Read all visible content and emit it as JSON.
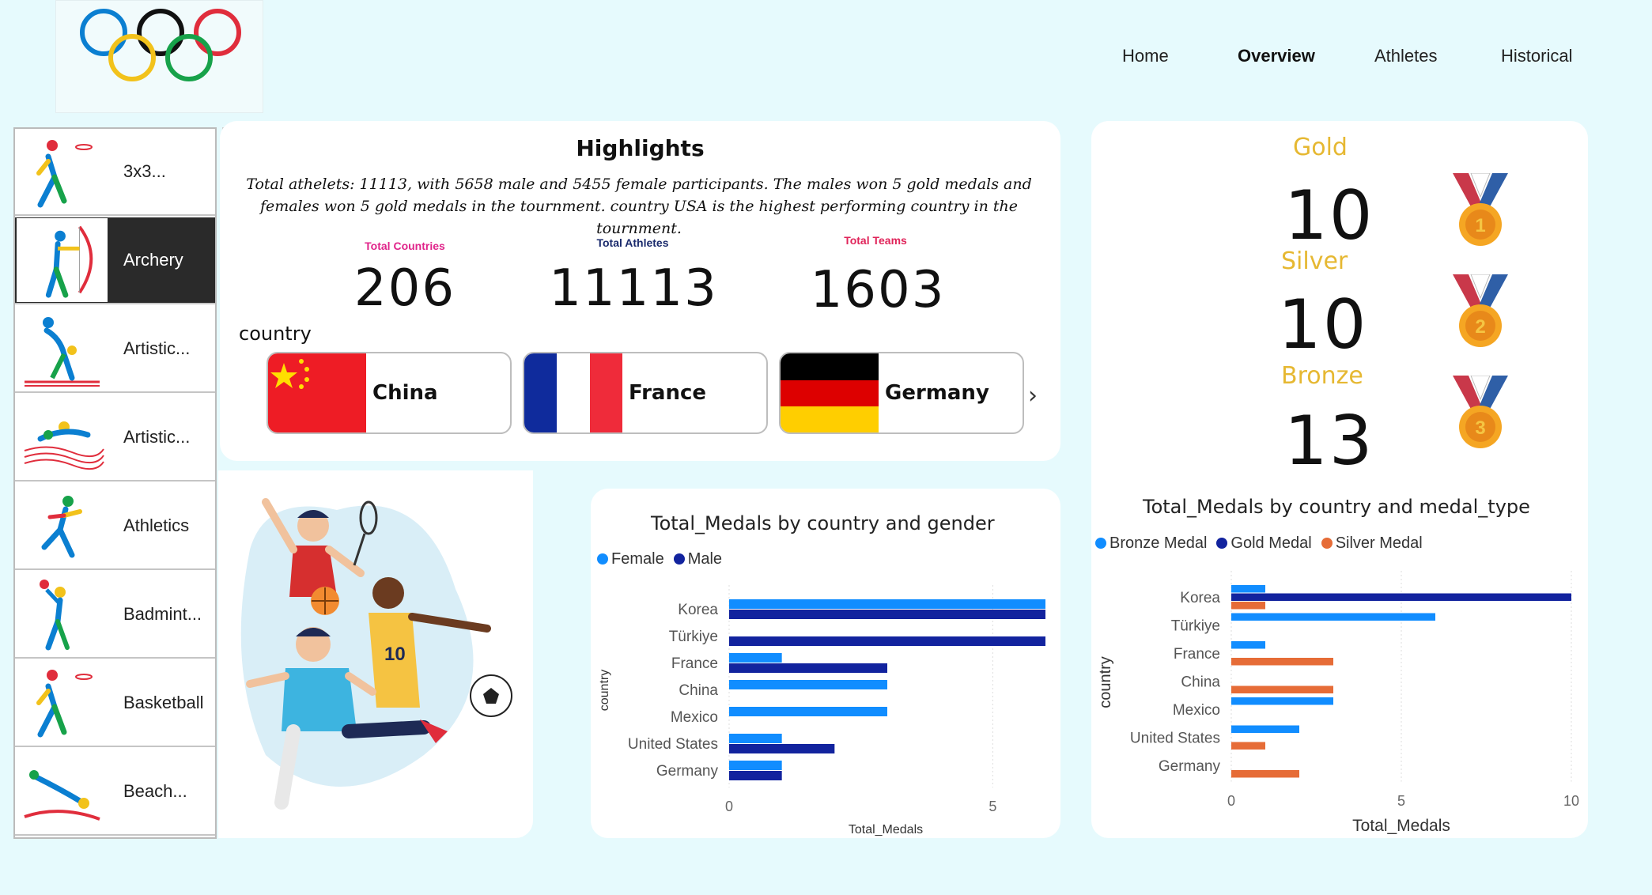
{
  "nav": {
    "home": "Home",
    "overview": "Overview",
    "athletes": "Athletes",
    "historical": "Historical"
  },
  "sports": [
    {
      "label": "3x3..."
    },
    {
      "label": "Archery"
    },
    {
      "label": "Artistic..."
    },
    {
      "label": "Artistic..."
    },
    {
      "label": "Athletics"
    },
    {
      "label": "Badmint..."
    },
    {
      "label": "Basketball"
    },
    {
      "label": "Beach..."
    }
  ],
  "more_options": "...",
  "highlights": {
    "title": "Highlights",
    "text": "Total athelets: 11113, with 5658 male and 5455 female participants. The males won 5 gold medals and females won 5 gold medals in the tournment. country USA is the highest performing country in the tournment."
  },
  "kpis": {
    "countries": {
      "label": "Total Countries",
      "value": "206",
      "color": "#e0248a"
    },
    "athletes": {
      "label": "Total Athletes",
      "value": "11113",
      "color": "#1a2a6c"
    },
    "teams": {
      "label": "Total Teams",
      "value": "1603",
      "color": "#e0245a"
    }
  },
  "country_slicer": {
    "label": "country",
    "items": [
      {
        "name": "China"
      },
      {
        "name": "France"
      },
      {
        "name": "Germany"
      }
    ],
    "next_icon": "chevron-right-icon"
  },
  "medals": {
    "gold": {
      "label": "Gold",
      "value": "10",
      "rank": "1"
    },
    "silver": {
      "label": "Silver",
      "value": "10",
      "rank": "2"
    },
    "bronze": {
      "label": "Bronze",
      "value": "13",
      "rank": "3"
    }
  },
  "colors": {
    "female": "#118dff",
    "male": "#12239e",
    "bronze_medal": "#118dff",
    "gold_medal": "#12239e",
    "silver_medal": "#e66c37",
    "medal_label": "#e6b832"
  },
  "chart_data": [
    {
      "type": "bar",
      "title": "Total_Medals by country and gender",
      "xlabel": "Total_Medals",
      "ylabel": "country",
      "categories": [
        "Korea",
        "Türkiye",
        "France",
        "China",
        "Mexico",
        "United States",
        "Germany"
      ],
      "series": [
        {
          "name": "Female",
          "values": [
            6,
            0,
            1,
            3,
            3,
            1,
            1
          ]
        },
        {
          "name": "Male",
          "values": [
            6,
            6,
            3,
            0,
            0,
            2,
            1
          ]
        }
      ],
      "xlim": [
        0,
        6
      ],
      "ticks": [
        "0",
        "5"
      ],
      "legend": "top-left"
    },
    {
      "type": "bar",
      "title": "Total_Medals by country and medal_type",
      "xlabel": "Total_Medals",
      "ylabel": "country",
      "categories": [
        "Korea",
        "Türkiye",
        "France",
        "China",
        "Mexico",
        "United States",
        "Germany"
      ],
      "series": [
        {
          "name": "Bronze Medal",
          "values": [
            1,
            6,
            1,
            0,
            3,
            2,
            0
          ]
        },
        {
          "name": "Gold Medal",
          "values": [
            10,
            0,
            0,
            0,
            0,
            0,
            0
          ]
        },
        {
          "name": "Silver Medal",
          "values": [
            1,
            0,
            3,
            3,
            0,
            1,
            2
          ]
        }
      ],
      "xlim": [
        0,
        10
      ],
      "ticks": [
        "0",
        "5",
        "10"
      ],
      "legend": "top-left"
    }
  ]
}
